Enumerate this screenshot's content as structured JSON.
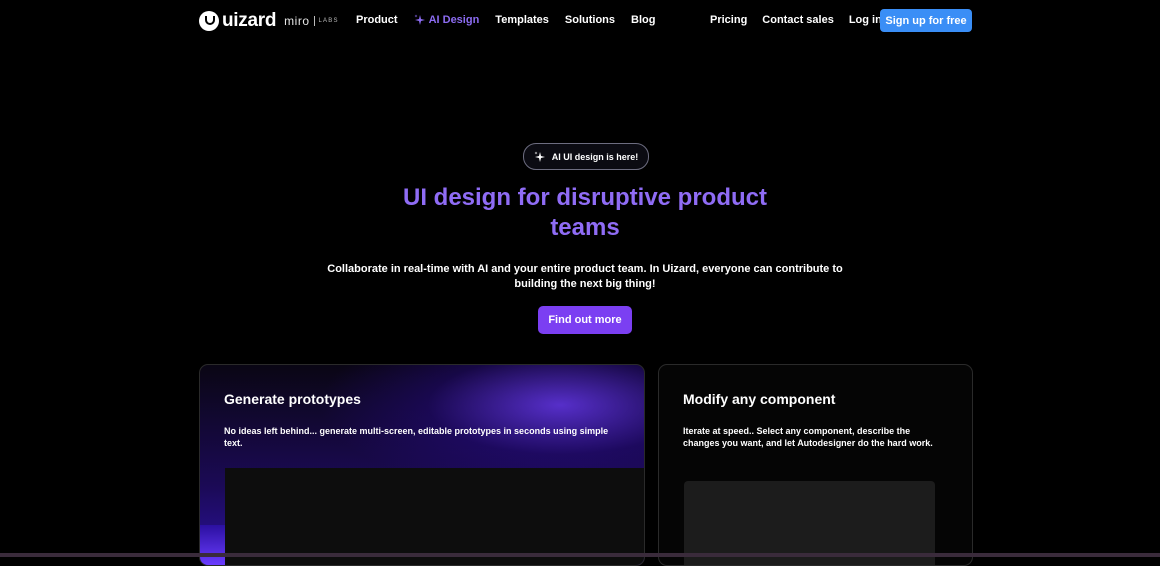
{
  "nav": {
    "logo_word": "uizard",
    "logo_miro": "miro",
    "logo_labs": "LABS",
    "left_items": [
      "Product",
      "AI Design",
      "Templates",
      "Solutions",
      "Blog"
    ],
    "right_items": [
      "Pricing",
      "Contact sales",
      "Log in"
    ],
    "signup_label": "Sign up for free"
  },
  "hero": {
    "badge": "AI UI design is here!",
    "title": "UI design for disruptive product teams",
    "subtitle": "Collaborate in real-time with AI and your entire product team. In Uizard, everyone can contribute to building the next big thing!",
    "cta_label": "Find out more"
  },
  "cards": [
    {
      "title": "Generate prototypes",
      "text": "No ideas left behind... generate multi-screen, editable prototypes in seconds using simple text."
    },
    {
      "title": "Modify any component",
      "text": "Iterate at speed.. Select any component, describe the changes you want, and let Autodesigner do the hard work."
    }
  ],
  "colors": {
    "accent_purple": "#8c6cf2",
    "signup_blue": "#3a8ef6",
    "cta_purple": "#7b3ff2"
  },
  "icons": {
    "ai_sparkle": "sparkle-icon"
  }
}
